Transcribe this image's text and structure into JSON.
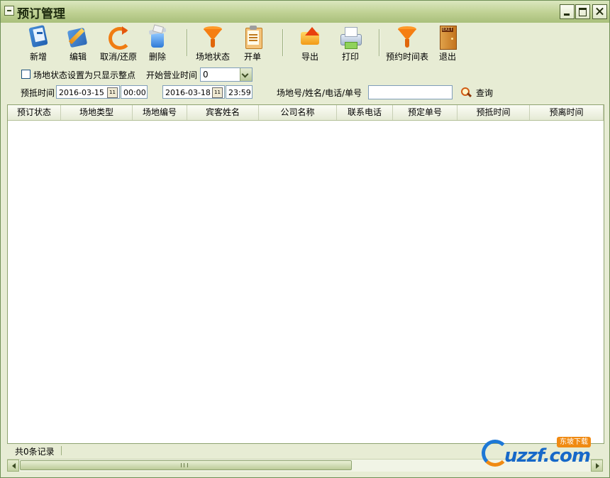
{
  "window": {
    "title": "预订管理"
  },
  "toolbar": {
    "buttons": [
      {
        "label": "新增",
        "icon": "add-document-icon"
      },
      {
        "label": "编辑",
        "icon": "edit-pencil-icon"
      },
      {
        "label": "取消/还原",
        "icon": "undo-refresh-icon"
      },
      {
        "label": "删除",
        "icon": "trash-bin-icon"
      },
      {
        "label": "场地状态",
        "icon": "funnel-icon"
      },
      {
        "label": "开单",
        "icon": "clipboard-icon"
      },
      {
        "label": "导出",
        "icon": "export-icon"
      },
      {
        "label": "打印",
        "icon": "printer-icon"
      },
      {
        "label": "预约时间表",
        "icon": "funnel-icon"
      },
      {
        "label": "退出",
        "icon": "exit-door-icon"
      }
    ]
  },
  "options": {
    "whole_hour_checkbox_label": "场地状态设置为只显示整点",
    "whole_hour_checked": false,
    "business_start_label": "开始营业时间",
    "business_start_value": "0"
  },
  "filter": {
    "arrival_label": "预抵时间",
    "start_date": "2016-03-15",
    "start_time": "00:00",
    "end_date": "2016-03-18",
    "end_time": "23:59",
    "calendar_icon_text": "11",
    "search_label": "场地号/姓名/电话/单号",
    "search_value": "",
    "query_label": "查询"
  },
  "grid": {
    "columns": [
      "预订状态",
      "场地类型",
      "场地编号",
      "宾客姓名",
      "公司名称",
      "联系电话",
      "预定单号",
      "预抵时间",
      "预离时间"
    ],
    "rows": []
  },
  "status": {
    "record_count_text": "共0条记录"
  },
  "watermark": {
    "logo_text": "uzzf.com",
    "tag_text": "东坡下载"
  },
  "colors": {
    "titlebar": "#bfd193",
    "window_bg": "#e7ecd4",
    "accent_orange": "#f57e12",
    "accent_blue": "#1f5fb0"
  }
}
